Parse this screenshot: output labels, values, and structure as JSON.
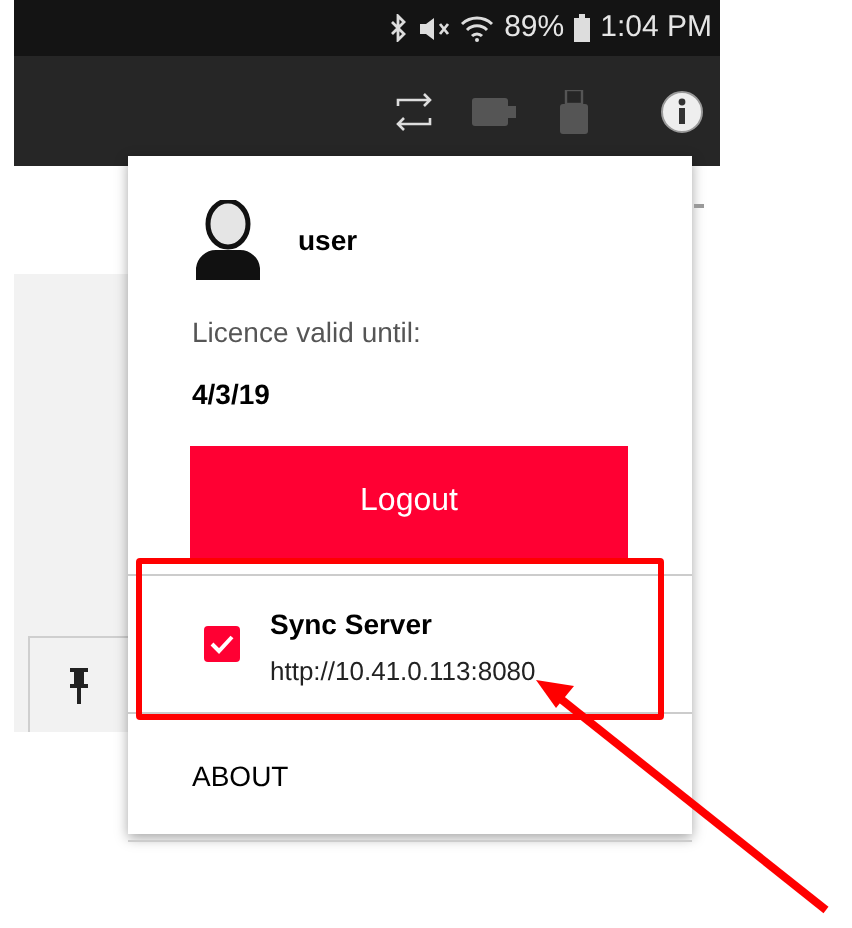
{
  "status_bar": {
    "battery": "89%",
    "time": "1:04 PM"
  },
  "menu": {
    "user": "user",
    "licence_label": "Licence valid until:",
    "licence_date": "4/3/19",
    "logout_button": "Logout",
    "sync": {
      "title": "Sync Server",
      "url": "http://10.41.0.113:8080",
      "checked": true
    },
    "about": "ABOUT"
  },
  "annotations": {
    "highlight_box": true,
    "arrow": true
  }
}
